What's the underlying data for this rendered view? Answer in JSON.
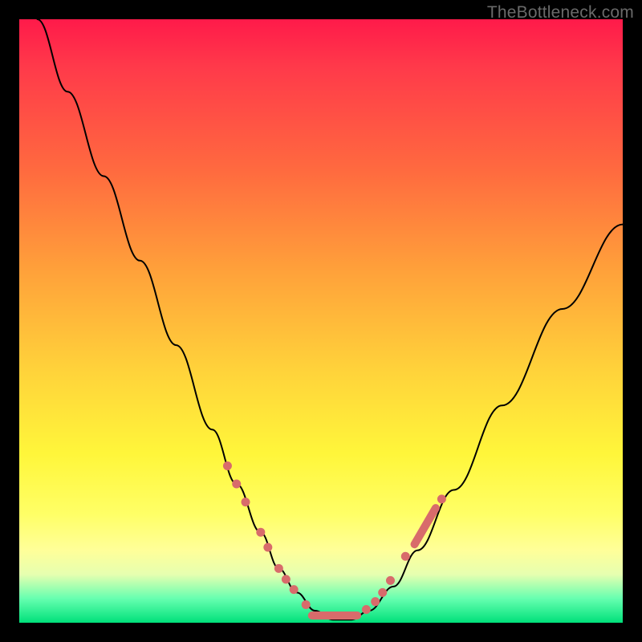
{
  "watermark": "TheBottleneck.com",
  "chart_data": {
    "type": "line",
    "title": "",
    "xlabel": "",
    "ylabel": "",
    "xlim": [
      0,
      100
    ],
    "ylim": [
      0,
      100
    ],
    "series": [
      {
        "name": "curve",
        "x": [
          3,
          8,
          14,
          20,
          26,
          32,
          36,
          40,
          43,
          46,
          49,
          52,
          55,
          58,
          62,
          66,
          72,
          80,
          90,
          100
        ],
        "y": [
          100,
          88,
          74,
          60,
          46,
          32,
          23,
          15,
          9,
          5,
          2,
          0.5,
          0.5,
          2,
          6,
          12,
          22,
          36,
          52,
          66
        ]
      }
    ],
    "markers": {
      "left_descent": [
        {
          "x": 34.5,
          "y": 26
        },
        {
          "x": 36.0,
          "y": 23
        },
        {
          "x": 37.5,
          "y": 20
        },
        {
          "x": 40.0,
          "y": 15
        },
        {
          "x": 41.2,
          "y": 12.5
        },
        {
          "x": 43.0,
          "y": 9
        },
        {
          "x": 44.2,
          "y": 7.2
        },
        {
          "x": 45.5,
          "y": 5.5
        },
        {
          "x": 47.5,
          "y": 3.0
        }
      ],
      "bottom_flat_segment": {
        "x1": 48.5,
        "y1": 1.2,
        "x2": 56.0,
        "y2": 1.2
      },
      "right_ascent": [
        {
          "x": 57.5,
          "y": 2.2
        },
        {
          "x": 59.0,
          "y": 3.5
        },
        {
          "x": 60.2,
          "y": 5.0
        },
        {
          "x": 61.5,
          "y": 7.0
        },
        {
          "x": 64.0,
          "y": 11.0
        }
      ],
      "right_cluster_segment": {
        "x1": 65.5,
        "y1": 13.0,
        "x2": 69.0,
        "y2": 19.0
      },
      "right_tail": [
        {
          "x": 70.0,
          "y": 20.5
        }
      ]
    }
  }
}
